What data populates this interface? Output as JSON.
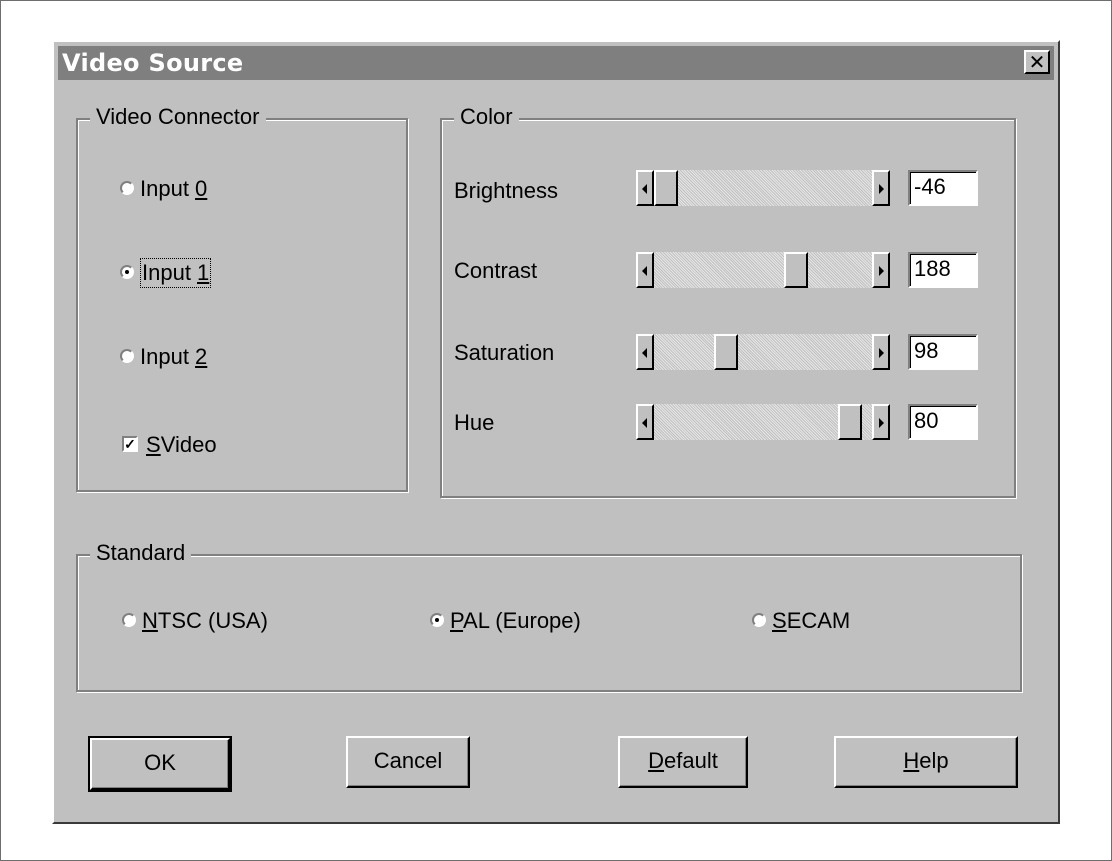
{
  "window": {
    "title": "Video Source",
    "close_glyph": "✕"
  },
  "video_connector": {
    "legend": "Video Connector",
    "inputs": [
      {
        "pre": "Input ",
        "mnemonic": "0",
        "selected": false
      },
      {
        "pre": "Input ",
        "mnemonic": "1",
        "selected": true
      },
      {
        "pre": "Input ",
        "mnemonic": "2",
        "selected": false
      }
    ],
    "svideo": {
      "mnemonic": "S",
      "rest": "Video",
      "checked": true
    }
  },
  "color": {
    "legend": "Color",
    "controls": [
      {
        "label": "Brightness",
        "value": "-46",
        "level": 0.0
      },
      {
        "label": "Contrast",
        "value": "188",
        "level": 0.67
      },
      {
        "label": "Saturation",
        "value": "98",
        "level": 0.31
      },
      {
        "label": "Hue",
        "value": "80",
        "level": 0.95
      }
    ]
  },
  "standard": {
    "legend": "Standard",
    "options": [
      {
        "mnemonic": "N",
        "rest": "TSC (USA)",
        "selected": false
      },
      {
        "mnemonic": "P",
        "rest": "AL (Europe)",
        "selected": true
      },
      {
        "mnemonic": "S",
        "rest": "ECAM",
        "selected": false
      }
    ]
  },
  "buttons": {
    "ok": "OK",
    "cancel": "Cancel",
    "default_mnemonic": "D",
    "default_rest": "efault",
    "help_mnemonic": "H",
    "help_rest": "elp"
  }
}
